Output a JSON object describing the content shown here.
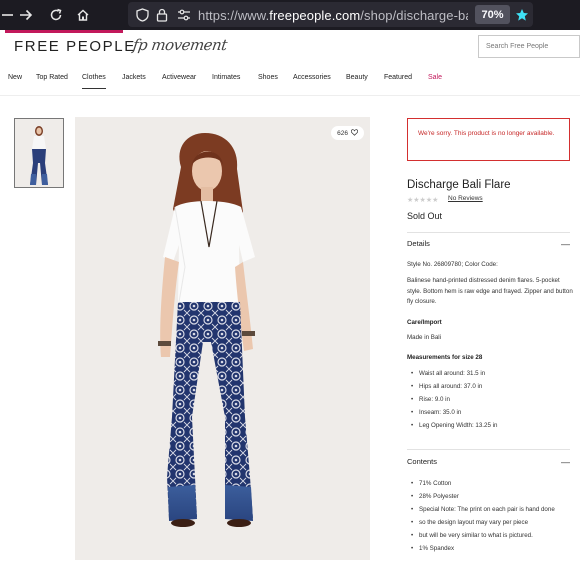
{
  "browser": {
    "url_prefix": "https://www.",
    "url_domain": "freepeople.com",
    "url_path": "/shop/discharge-bali-flare",
    "zoom": "70%"
  },
  "header": {
    "logo": "FREE PEOPLE",
    "sub_brand": "fp movement",
    "search_placeholder": "Search Free People"
  },
  "nav": {
    "items": [
      "New",
      "Top Rated",
      "Clothes",
      "Jackets",
      "Activewear",
      "Intimates",
      "Shoes",
      "Accessories",
      "Beauty",
      "Featured",
      "Sale"
    ],
    "active": "Clothes"
  },
  "gallery": {
    "likes": "626"
  },
  "product": {
    "alert": "We're sorry. This product is no longer available.",
    "title": "Discharge Bali Flare",
    "reviews_link": "No Reviews",
    "rating_stars": 0,
    "status": "Sold Out",
    "details_label": "Details",
    "style_line": "Style No. 26809780; Color Code:",
    "description": "Balinese hand-printed distressed denim flares. 5-pocket style. Bottom hem is raw edge and frayed. Zipper and button fly closure.",
    "care_head": "Care/Import",
    "care_text": "Made in Bali",
    "measure_head": "Measurements for size 28",
    "measurements": [
      "Waist all around: 31.5 in",
      "Hips all around: 37.0 in",
      "Rise: 9.0 in",
      "Inseam: 35.0 in",
      "Leg Opening Width: 13.25 in"
    ],
    "contents_label": "Contents",
    "contents": [
      "71% Cotton",
      "28% Polyester",
      "Special Note: The print on each pair is hand done",
      "so the design layout may vary per piece",
      "but will be very similar to what is pictured.",
      "1% Spandex"
    ]
  }
}
